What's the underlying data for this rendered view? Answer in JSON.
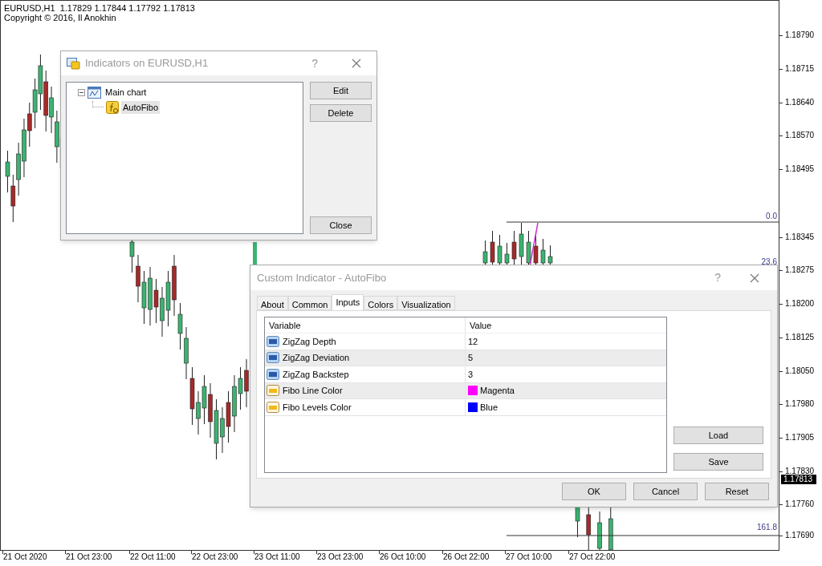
{
  "chart": {
    "header": "EURUSD,H1  1.17829 1.17844 1.17792 1.17813",
    "copyright": "Copyright © 2016, Il Anokhin",
    "price_labels": [
      "1.18790",
      "1.18715",
      "1.18640",
      "1.18570",
      "1.18495",
      "1.18345",
      "1.18275",
      "1.18200",
      "1.18125",
      "1.18050",
      "1.17980",
      "1.17905",
      "1.17830",
      "1.17760",
      "1.17690"
    ],
    "current_price": "1.17813",
    "time_labels": [
      "21 Oct 2020",
      "21 Oct 23:00",
      "22 Oct 11:00",
      "22 Oct 23:00",
      "23 Oct 11:00",
      "23 Oct 23:00",
      "26 Oct 10:00",
      "26 Oct 22:00",
      "27 Oct 10:00",
      "27 Oct 22:00"
    ],
    "fibo_levels": [
      "0.0",
      "23.6",
      "161.8"
    ]
  },
  "indicators_dialog": {
    "title": "Indicators on EURUSD,H1",
    "help": "?",
    "tree": [
      {
        "label": "Main chart",
        "expanded": true,
        "selected": false,
        "children": [
          {
            "label": "AutoFibo",
            "selected": true
          }
        ]
      }
    ],
    "buttons": [
      "Edit",
      "Delete",
      "Close"
    ]
  },
  "custom_dialog": {
    "title": "Custom Indicator - AutoFibo",
    "help": "?",
    "tabs": [
      {
        "label": "About",
        "selected": false
      },
      {
        "label": "Common",
        "selected": false
      },
      {
        "label": "Inputs",
        "selected": true
      },
      {
        "label": "Colors",
        "selected": false
      },
      {
        "label": "Visualization",
        "selected": false
      }
    ],
    "columns": [
      "Variable",
      "Value"
    ],
    "rows": [
      {
        "kind": "number",
        "variable": "ZigZag Depth",
        "value": "12",
        "selected": false
      },
      {
        "kind": "number",
        "variable": "ZigZag Deviation",
        "value": "5",
        "selected": true
      },
      {
        "kind": "number",
        "variable": "ZigZag Backstep",
        "value": "3",
        "selected": false
      },
      {
        "kind": "color",
        "variable": "Fibo Line Color",
        "value": "Magenta",
        "color": "#ff00ff",
        "selected": true
      },
      {
        "kind": "color",
        "variable": "Fibo Levels Color",
        "value": "Blue",
        "color": "#0000ff",
        "selected": false
      }
    ],
    "side_buttons": [
      "Load",
      "Save"
    ],
    "buttons": [
      "OK",
      "Cancel",
      "Reset"
    ]
  }
}
